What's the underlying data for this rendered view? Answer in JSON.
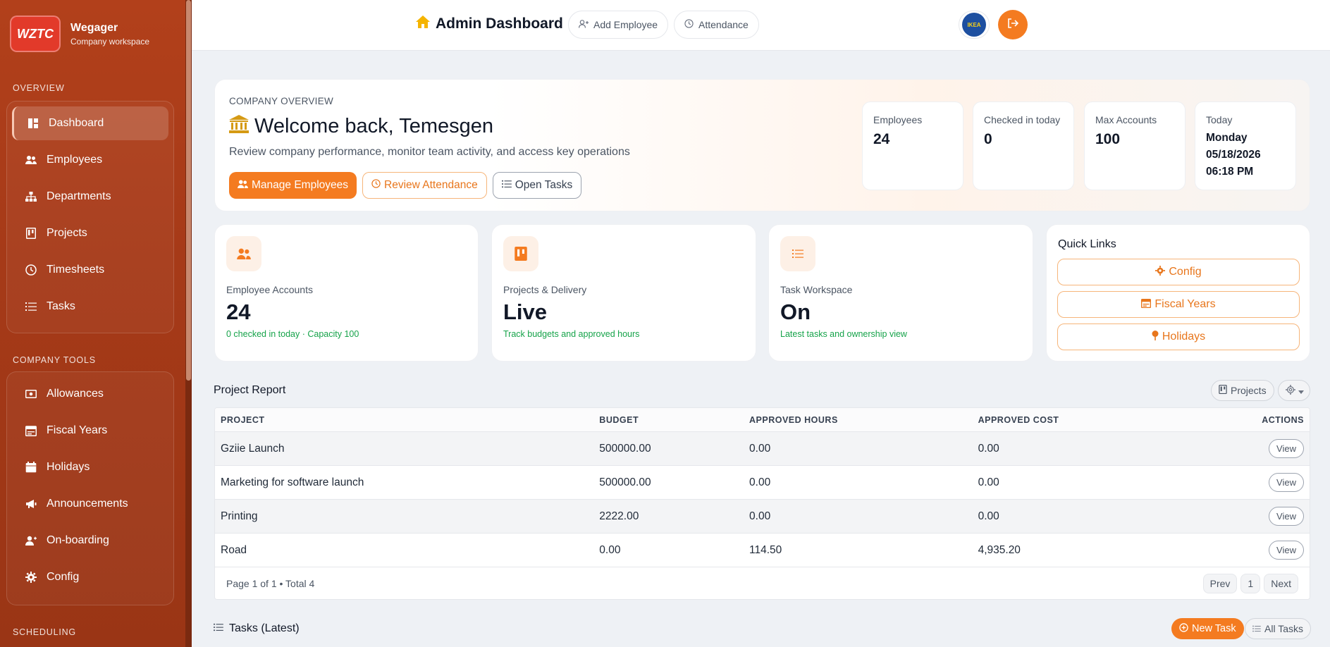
{
  "brand": {
    "logo_text": "WZTC",
    "name": "Wegager",
    "subtitle": "Company workspace"
  },
  "sidebar": {
    "overview_label": "OVERVIEW",
    "overview_items": [
      {
        "label": "Dashboard",
        "icon": "dashboard-icon"
      },
      {
        "label": "Employees",
        "icon": "users-icon"
      },
      {
        "label": "Departments",
        "icon": "sitemap-icon"
      },
      {
        "label": "Projects",
        "icon": "kanban-icon"
      },
      {
        "label": "Timesheets",
        "icon": "clock-icon"
      },
      {
        "label": "Tasks",
        "icon": "list-icon"
      }
    ],
    "tools_label": "COMPANY TOOLS",
    "tools_items": [
      {
        "label": "Allowances",
        "icon": "money-icon"
      },
      {
        "label": "Fiscal Years",
        "icon": "calendar-icon"
      },
      {
        "label": "Holidays",
        "icon": "calendar-event-icon"
      },
      {
        "label": "Announcements",
        "icon": "megaphone-icon"
      },
      {
        "label": "On-boarding",
        "icon": "user-add-icon"
      },
      {
        "label": "Config",
        "icon": "gear-icon"
      }
    ],
    "scheduling_label": "SCHEDULING"
  },
  "topbar": {
    "title": "Admin Dashboard",
    "add_employee": "Add Employee",
    "attendance": "Attendance",
    "avatar_text": "IKEA"
  },
  "hero": {
    "eyebrow": "COMPANY OVERVIEW",
    "title": "Welcome back, Temesgen",
    "description": "Review company performance, monitor team activity, and access key operations",
    "btn_manage": "Manage Employees",
    "btn_review": "Review Attendance",
    "btn_tasks": "Open Tasks",
    "stats": {
      "employees_label": "Employees",
      "employees_value": "24",
      "checked_label": "Checked in today",
      "checked_value": "0",
      "max_label": "Max Accounts",
      "max_value": "100",
      "today_label": "Today",
      "today_day": "Monday",
      "today_date": "05/18/2026",
      "today_time": "06:18 PM"
    }
  },
  "cards": {
    "employees": {
      "label": "Employee Accounts",
      "value": "24",
      "sub": "0 checked in today · Capacity 100"
    },
    "projects": {
      "label": "Projects & Delivery",
      "value": "Live",
      "sub": "Track budgets and approved hours"
    },
    "tasks": {
      "label": "Task Workspace",
      "value": "On",
      "sub": "Latest tasks and ownership view"
    },
    "quick_links": {
      "title": "Quick Links",
      "config": "Config",
      "fiscal": "Fiscal Years",
      "holidays": "Holidays"
    }
  },
  "project_report": {
    "title": "Project Report",
    "projects_btn": "Projects",
    "headers": {
      "project": "PROJECT",
      "budget": "BUDGET",
      "hours": "APPROVED HOURS",
      "cost": "APPROVED COST",
      "actions": "ACTIONS"
    },
    "rows": [
      {
        "project": "Gziie Launch",
        "budget": "500000.00",
        "hours": "0.00",
        "cost": "0.00",
        "action": "View"
      },
      {
        "project": "Marketing for software launch",
        "budget": "500000.00",
        "hours": "0.00",
        "cost": "0.00",
        "action": "View"
      },
      {
        "project": "Printing",
        "budget": "2222.00",
        "hours": "0.00",
        "cost": "0.00",
        "action": "View"
      },
      {
        "project": "Road",
        "budget": "0.00",
        "hours": "114.50",
        "cost": "4,935.20",
        "action": "View"
      }
    ],
    "footer": "Page 1 of 1 • Total 4",
    "prev": "Prev",
    "page": "1",
    "next": "Next"
  },
  "tasks_section": {
    "title": "Tasks (Latest)",
    "new_task": "New Task",
    "all_tasks": "All Tasks"
  },
  "colors": {
    "accent": "#f47b20",
    "sidebar": "#a63a18",
    "success": "#16a34a"
  }
}
